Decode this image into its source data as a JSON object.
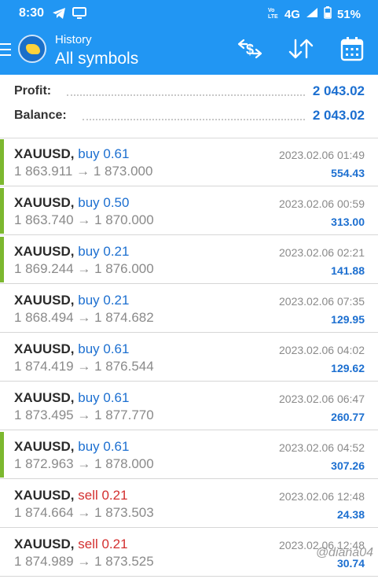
{
  "status_bar": {
    "time": "8:30",
    "network": "4G",
    "battery": "51%",
    "icons": [
      "telegram-icon",
      "tv-icon",
      "volte-icon",
      "signal-icon",
      "battery-icon"
    ]
  },
  "header": {
    "subtitle": "History",
    "title": "All symbols",
    "icons": [
      "metatrader-logo",
      "currency-exchange-icon",
      "sort-icon",
      "calendar-icon"
    ]
  },
  "summary": {
    "profit_label": "Profit:",
    "profit_value": "2 043.02",
    "balance_label": "Balance:",
    "balance_value": "2 043.02"
  },
  "deals": [
    {
      "symbol": "XAUUSD,",
      "type": "buy 0.61",
      "prices": "1 863.911 → 1 873.000",
      "time": "2023.02.06 01:49",
      "profit": "554.43",
      "marked": true
    },
    {
      "symbol": "XAUUSD,",
      "type": "buy 0.50",
      "prices": "1 863.740 → 1 870.000",
      "time": "2023.02.06 00:59",
      "profit": "313.00",
      "marked": true
    },
    {
      "symbol": "XAUUSD,",
      "type": "buy 0.21",
      "prices": "1 869.244 → 1 876.000",
      "time": "2023.02.06 02:21",
      "profit": "141.88",
      "marked": true
    },
    {
      "symbol": "XAUUSD,",
      "type": "buy 0.21",
      "prices": "1 868.494 → 1 874.682",
      "time": "2023.02.06 07:35",
      "profit": "129.95",
      "marked": false
    },
    {
      "symbol": "XAUUSD,",
      "type": "buy 0.61",
      "prices": "1 874.419 → 1 876.544",
      "time": "2023.02.06 04:02",
      "profit": "129.62",
      "marked": false
    },
    {
      "symbol": "XAUUSD,",
      "type": "buy 0.61",
      "prices": "1 873.495 → 1 877.770",
      "time": "2023.02.06 06:47",
      "profit": "260.77",
      "marked": false
    },
    {
      "symbol": "XAUUSD,",
      "type": "buy 0.61",
      "prices": "1 872.963 → 1 878.000",
      "time": "2023.02.06 04:52",
      "profit": "307.26",
      "marked": true
    },
    {
      "symbol": "XAUUSD,",
      "type": "sell 0.21",
      "prices": "1 874.664 → 1 873.503",
      "time": "2023.02.06 12:48",
      "profit": "24.38",
      "marked": false
    },
    {
      "symbol": "XAUUSD,",
      "type": "sell 0.21",
      "prices": "1 874.989 → 1 873.525",
      "time": "2023.02.06 12:48",
      "profit": "30.74",
      "marked": false
    }
  ],
  "watermark": "@diana04",
  "colors": {
    "header_blue": "#2196f3",
    "value_blue": "#1c6fd0",
    "sell_red": "#d32f2f",
    "marker_green": "#7cb82f"
  }
}
